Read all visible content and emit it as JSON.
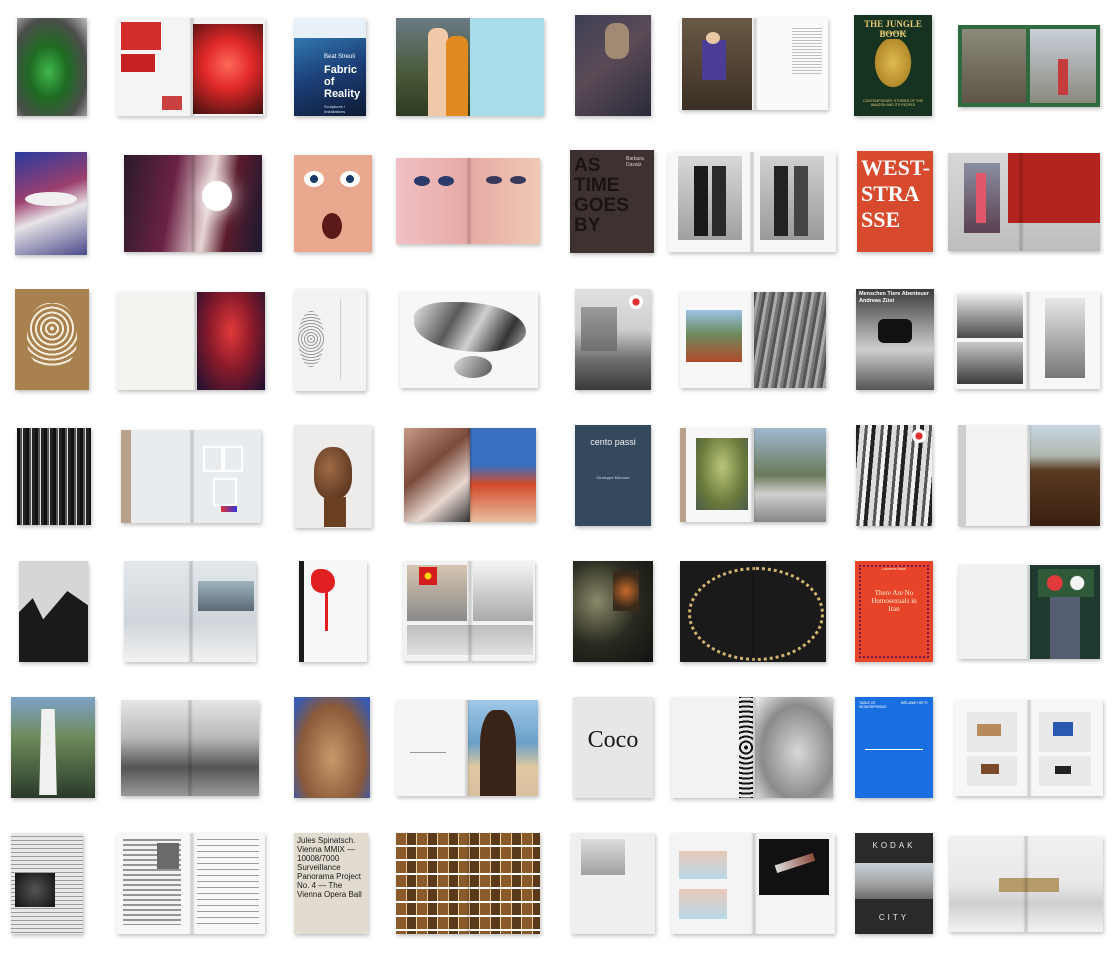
{
  "covers": {
    "fabric": {
      "line1": "Beat Streuli",
      "title": "Fabric of Reality",
      "sub": "Sculptures / Installations"
    },
    "jungle": {
      "title": "THE JUNGLE BOOK",
      "author": "YANN GROSS",
      "sub": "CONTEMPORARY STORIES OF THE AMAZON AND ITS PEOPLE"
    },
    "astime": {
      "title": "AS TIME GOES BY",
      "author": "Barbara Davatz"
    },
    "weststrasse": {
      "title": "WEST-STRASSE"
    },
    "menschen": {
      "line1": "Menschen Tiere Abenteuer",
      "author": "Andreas Züst"
    },
    "centopassi": {
      "title": "cento passi",
      "author": "Giuseppe Mizzone"
    },
    "iran": {
      "title": "There Are No Homosexuals in Iran",
      "author": "Laurence Rasti"
    },
    "coco": {
      "title": "Coco"
    },
    "blue": {
      "left": "TABLE OF ISOMORPHISMS",
      "right": "MÉLANIE HEFTI"
    },
    "jules": {
      "text": "Jules Spinatsch. Vienna MMIX — 10008/7000 Surveillance Panorama Project No. 4 — The Vienna Opera Ball"
    },
    "kodak": {
      "top": "KODAK",
      "bottom": "CITY"
    }
  }
}
